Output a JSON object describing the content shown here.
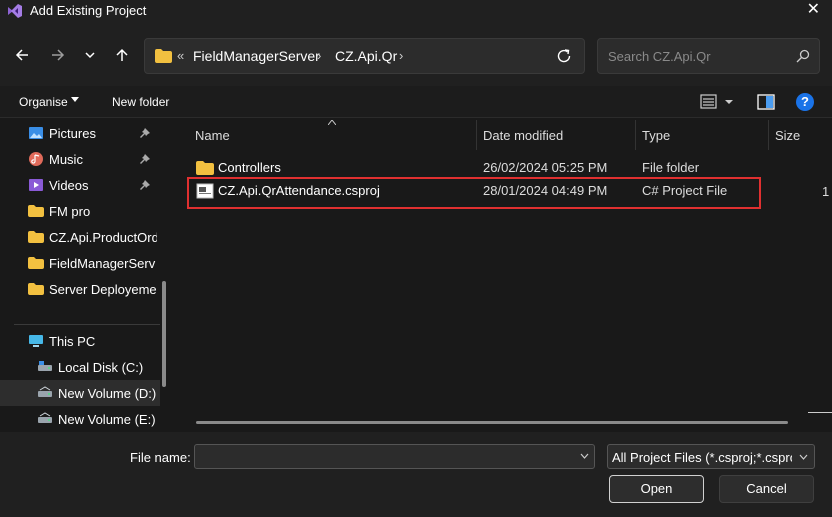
{
  "window": {
    "title": "Add Existing Project",
    "close_glyph": "✕",
    "app_icon": "visual-studio-icon"
  },
  "navigation": {
    "back_icon": "arrow-left-icon",
    "forward_icon": "arrow-right-icon",
    "recent_icon": "chevron-down-icon",
    "up_icon": "arrow-up-icon"
  },
  "address_bar": {
    "overflow_glyph": "«",
    "segments": [
      "FieldManagerServer",
      "CZ.Api.Qr"
    ],
    "separator_glyph": "›"
  },
  "search": {
    "placeholder": "Search CZ.Api.Qr"
  },
  "toolbar": {
    "organise_label": "Organise",
    "new_folder_label": "New folder",
    "help_glyph": "?"
  },
  "sidebar": {
    "items": [
      {
        "label": "Pictures",
        "icon": "pictures-icon",
        "pinned": true
      },
      {
        "label": "Music",
        "icon": "music-icon",
        "pinned": true
      },
      {
        "label": "Videos",
        "icon": "videos-icon",
        "pinned": true
      },
      {
        "label": "FM pro",
        "icon": "folder-icon",
        "pinned": false
      },
      {
        "label": "CZ.Api.ProductOrd",
        "icon": "folder-icon",
        "pinned": false
      },
      {
        "label": "FieldManagerServ",
        "icon": "folder-icon",
        "pinned": false
      },
      {
        "label": "Server Deployeme",
        "icon": "folder-icon",
        "pinned": false
      },
      {
        "label": "This PC",
        "icon": "computer-icon",
        "pinned": false
      },
      {
        "label": "Local Disk (C:)",
        "icon": "drive-icon",
        "pinned": false
      },
      {
        "label": "New Volume (D:)",
        "icon": "drive-icon",
        "pinned": false,
        "selected": true
      },
      {
        "label": "New Volume (E:)",
        "icon": "drive-icon",
        "pinned": false
      }
    ]
  },
  "file_list": {
    "columns": [
      "Name",
      "Date modified",
      "Type",
      "Size"
    ],
    "rows": [
      {
        "name": "Controllers",
        "date": "26/02/2024 05:25 PM",
        "type": "File folder",
        "icon": "folder-icon"
      },
      {
        "name": "CZ.Api.QrAttendance.csproj",
        "date": "28/01/2024 04:49 PM",
        "type": "C# Project File",
        "icon": "project-file-icon",
        "highlighted": true
      }
    ],
    "truncated_size_text": "1"
  },
  "footer": {
    "file_name_label": "File name:",
    "file_name_value": "",
    "filter_value": "All Project Files (*.csproj;*.csproj",
    "open_label": "Open",
    "cancel_label": "Cancel"
  },
  "colors": {
    "highlight_border": "#e03030",
    "folder": "#f2c040",
    "help_blue": "#1a73e8"
  }
}
